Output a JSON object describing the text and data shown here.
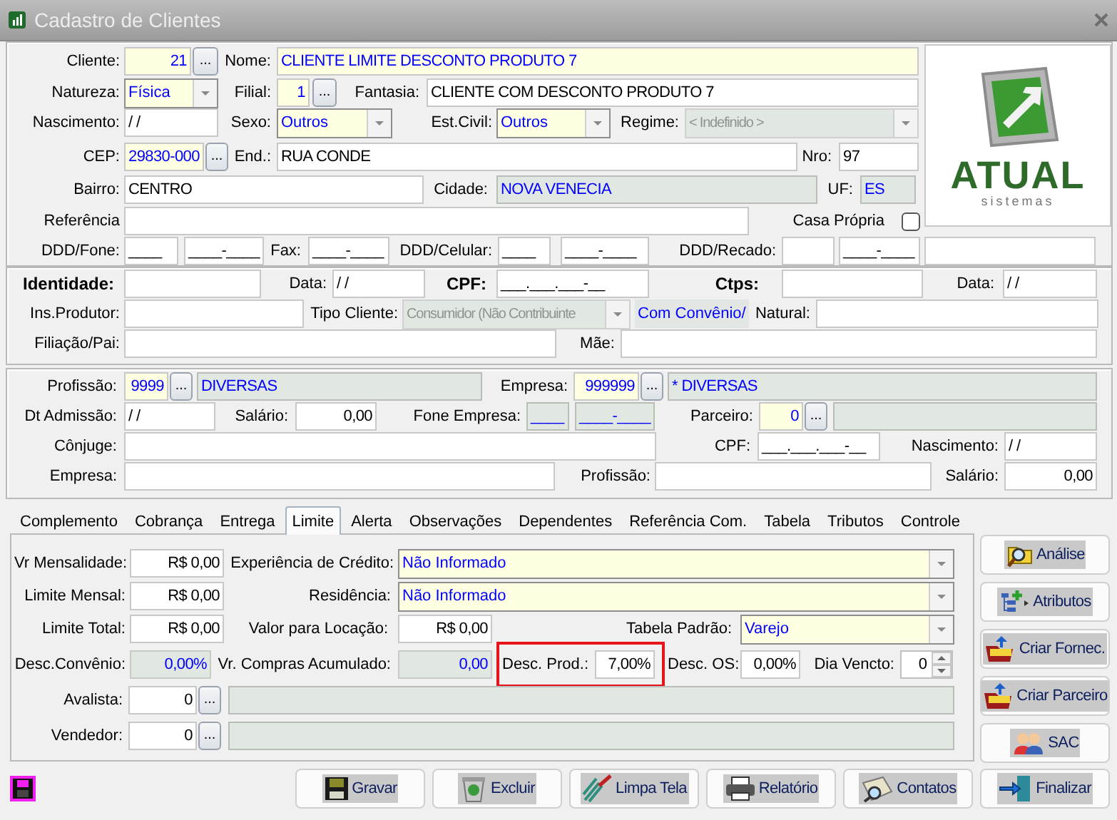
{
  "window": {
    "title": "Cadastro de Clientes"
  },
  "logo": {
    "name": "ATUAL",
    "tagline": "sistemas"
  },
  "client_rows": [
    [
      {
        "kind": "label",
        "text": "Cliente:"
      },
      {
        "kind": "key-field",
        "value": "21"
      },
      {
        "kind": "lookup",
        "label": "..."
      },
      {
        "kind": "label",
        "text": "Nome:"
      },
      {
        "kind": "key-text",
        "value": "CLIENTE LIMITE DESCONTO PRODUTO 7"
      }
    ],
    [
      {
        "kind": "label",
        "text": "Natureza:"
      },
      {
        "kind": "combo",
        "value": "Física"
      },
      {
        "kind": "label",
        "text": "Filial:"
      },
      {
        "kind": "key-field",
        "value": "1"
      },
      {
        "kind": "lookup",
        "label": "..."
      },
      {
        "kind": "label",
        "text": "Fantasia:"
      },
      {
        "kind": "field",
        "value": "CLIENTE COM DESCONTO PRODUTO 7"
      }
    ],
    [
      {
        "kind": "label",
        "text": "Nascimento:"
      },
      {
        "kind": "field",
        "value": "/ /"
      },
      {
        "kind": "label",
        "text": "Sexo:"
      },
      {
        "kind": "combo",
        "value": "Outros"
      },
      {
        "kind": "label",
        "text": "Est.Civil:"
      },
      {
        "kind": "combo",
        "value": "Outros"
      },
      {
        "kind": "label",
        "text": "Regime:"
      },
      {
        "kind": "locked-combo",
        "value": "< Indefinido >"
      }
    ],
    [
      {
        "kind": "label",
        "text": "CEP:"
      },
      {
        "kind": "key-text",
        "value": "29830-000"
      },
      {
        "kind": "lookup",
        "label": "..."
      },
      {
        "kind": "label",
        "text": "End.:"
      },
      {
        "kind": "field",
        "value": "RUA CONDE"
      },
      {
        "kind": "label",
        "text": "Nro:"
      },
      {
        "kind": "field",
        "value": "97"
      }
    ],
    [
      {
        "kind": "label",
        "text": "Bairro:"
      },
      {
        "kind": "field",
        "value": "CENTRO"
      },
      {
        "kind": "label",
        "text": "Cidade:"
      },
      {
        "kind": "locked-field",
        "value": "NOVA VENECIA"
      },
      {
        "kind": "label",
        "text": "UF:"
      },
      {
        "kind": "locked-field",
        "value": "ES"
      }
    ],
    [
      {
        "kind": "label",
        "text": "Referência"
      },
      {
        "kind": "field"
      },
      {
        "kind": "label",
        "text": "Casa Própria"
      },
      {
        "kind": "checkbox",
        "checked": false
      }
    ],
    [
      {
        "kind": "label",
        "text": "DDD/Fone:"
      },
      {
        "kind": "field",
        "value": "____"
      },
      {
        "kind": "field",
        "value": "____-____"
      },
      {
        "kind": "label",
        "text": "Fax:"
      },
      {
        "kind": "field",
        "value": "____-____"
      },
      {
        "kind": "label",
        "text": "DDD/Celular:"
      },
      {
        "kind": "field",
        "value": "____"
      },
      {
        "kind": "field",
        "value": "____-____"
      },
      {
        "kind": "label",
        "text": "DDD/Recado:"
      },
      {
        "kind": "field"
      },
      {
        "kind": "field",
        "value": "____-____"
      },
      {
        "kind": "field"
      }
    ]
  ],
  "document_rows": [
    [
      {
        "kind": "strong-label",
        "text": "Identidade:"
      },
      {
        "kind": "field"
      },
      {
        "kind": "label",
        "text": "Data:"
      },
      {
        "kind": "field",
        "value": "/ /"
      },
      {
        "kind": "strong-label",
        "text": "CPF:"
      },
      {
        "kind": "field",
        "value": "___.___.___-__"
      },
      {
        "kind": "strong-label",
        "text": "Ctps:"
      },
      {
        "kind": "field"
      },
      {
        "kind": "label",
        "text": "Data:"
      },
      {
        "kind": "field",
        "value": "/ /"
      }
    ],
    [
      {
        "kind": "label",
        "text": "Ins.Produtor:"
      },
      {
        "kind": "field"
      },
      {
        "kind": "label",
        "text": "Tipo Cliente:"
      },
      {
        "kind": "locked-combo",
        "value": "Consumidor (Não Contribuinte"
      },
      {
        "kind": "note",
        "text": "Com Convênio/"
      },
      {
        "kind": "label",
        "text": "Natural:"
      },
      {
        "kind": "field"
      }
    ],
    [
      {
        "kind": "label",
        "text": "Filiação/Pai:"
      },
      {
        "kind": "field"
      },
      {
        "kind": "label",
        "text": "Mãe:"
      },
      {
        "kind": "field"
      }
    ]
  ],
  "work_rows": [
    [
      {
        "kind": "label",
        "text": "Profissão:"
      },
      {
        "kind": "key-field",
        "value": "9999"
      },
      {
        "kind": "lookup",
        "label": "..."
      },
      {
        "kind": "locked-field",
        "value": "DIVERSAS"
      },
      {
        "kind": "label",
        "text": "Empresa:"
      },
      {
        "kind": "key-field",
        "value": "999999"
      },
      {
        "kind": "lookup",
        "label": "..."
      },
      {
        "kind": "locked-field",
        "value": "* DIVERSAS"
      }
    ],
    [
      {
        "kind": "label",
        "text": "Dt Admissão:"
      },
      {
        "kind": "field",
        "value": "/ /"
      },
      {
        "kind": "label",
        "text": "Salário:"
      },
      {
        "kind": "amount",
        "value": "0,00"
      },
      {
        "kind": "label",
        "text": "Fone Empresa:"
      },
      {
        "kind": "locked-field",
        "value": "____"
      },
      {
        "kind": "locked-field",
        "value": "____-____"
      },
      {
        "kind": "label",
        "text": "Parceiro:"
      },
      {
        "kind": "key-field",
        "value": "0"
      },
      {
        "kind": "lookup",
        "label": "..."
      },
      {
        "kind": "locked-field"
      }
    ],
    [
      {
        "kind": "label",
        "text": "Cônjuge:"
      },
      {
        "kind": "field"
      },
      {
        "kind": "label",
        "text": "CPF:"
      },
      {
        "kind": "field",
        "value": "___.___.___-__"
      },
      {
        "kind": "label",
        "text": "Nascimento:"
      },
      {
        "kind": "field",
        "value": "/ /"
      }
    ],
    [
      {
        "kind": "label",
        "text": "Empresa:"
      },
      {
        "kind": "field"
      },
      {
        "kind": "label",
        "text": "Profissão:"
      },
      {
        "kind": "field"
      },
      {
        "kind": "label",
        "text": "Salário:"
      },
      {
        "kind": "amount",
        "value": "0,00"
      }
    ]
  ],
  "tabs": [
    {
      "label": "Complemento",
      "selected": false
    },
    {
      "label": "Cobrança",
      "selected": false
    },
    {
      "label": "Entrega",
      "selected": false
    },
    {
      "label": "Limite",
      "selected": true
    },
    {
      "label": "Alerta",
      "selected": false
    },
    {
      "label": "Observações",
      "selected": false
    },
    {
      "label": "Dependentes",
      "selected": false
    },
    {
      "label": "Referência Com.",
      "selected": false
    },
    {
      "label": "Tabela",
      "selected": false
    },
    {
      "label": "Tributos",
      "selected": false
    },
    {
      "label": "Controle",
      "selected": false
    }
  ],
  "limit_rows": [
    [
      {
        "kind": "label",
        "text": "Vr Mensalidade:"
      },
      {
        "kind": "amount",
        "value": "R$ 0,00"
      },
      {
        "kind": "label",
        "text": "Experiência de Crédito:"
      },
      {
        "kind": "combo",
        "value": "Não Informado"
      }
    ],
    [
      {
        "kind": "label",
        "text": "Limite Mensal:"
      },
      {
        "kind": "amount",
        "value": "R$ 0,00"
      },
      {
        "kind": "label",
        "text": "Residência:"
      },
      {
        "kind": "combo",
        "value": "Não Informado"
      }
    ],
    [
      {
        "kind": "label",
        "text": "Limite Total:"
      },
      {
        "kind": "amount",
        "value": "R$ 0,00"
      },
      {
        "kind": "label",
        "text": "Valor para Locação:"
      },
      {
        "kind": "amount",
        "value": "R$ 0,00"
      },
      {
        "kind": "label",
        "text": "Tabela Padrão:"
      },
      {
        "kind": "combo",
        "value": "Varejo"
      }
    ],
    [
      {
        "kind": "label",
        "text": "Desc.Convênio:"
      },
      {
        "kind": "locked-amount",
        "value": "0,00%"
      },
      {
        "kind": "label",
        "text": "Vr. Compras Acumulado:"
      },
      {
        "kind": "locked-amount",
        "value": "0,00"
      },
      {
        "kind": "group",
        "highlighted": true,
        "items": [
          {
            "kind": "label",
            "text": "Desc. Prod.:"
          },
          {
            "kind": "amount",
            "value": "7,00%"
          }
        ]
      },
      {
        "kind": "label",
        "text": "Desc. OS:"
      },
      {
        "kind": "amount",
        "value": "0,00%"
      },
      {
        "kind": "label",
        "text": "Dia Vencto:"
      },
      {
        "kind": "spin",
        "value": "0"
      }
    ],
    [
      {
        "kind": "label",
        "text": "Avalista:"
      },
      {
        "kind": "amount",
        "value": "0"
      },
      {
        "kind": "lookup",
        "label": "..."
      },
      {
        "kind": "locked-field"
      }
    ],
    [
      {
        "kind": "label",
        "text": "Vendedor:"
      },
      {
        "kind": "amount",
        "value": "0"
      },
      {
        "kind": "lookup",
        "label": "..."
      },
      {
        "kind": "locked-field"
      }
    ]
  ],
  "side_buttons": [
    {
      "label": "Análise"
    },
    {
      "label": "Atributos"
    },
    {
      "label": "Criar Fornec."
    },
    {
      "label": "Criar Parceiro"
    },
    {
      "label": "SAC"
    }
  ],
  "footer_buttons": [
    {
      "label": "Gravar"
    },
    {
      "label": "Excluir"
    },
    {
      "label": "Limpa Tela"
    },
    {
      "label": "Relatório"
    },
    {
      "label": "Contatos"
    },
    {
      "label": "Finalizar"
    }
  ]
}
